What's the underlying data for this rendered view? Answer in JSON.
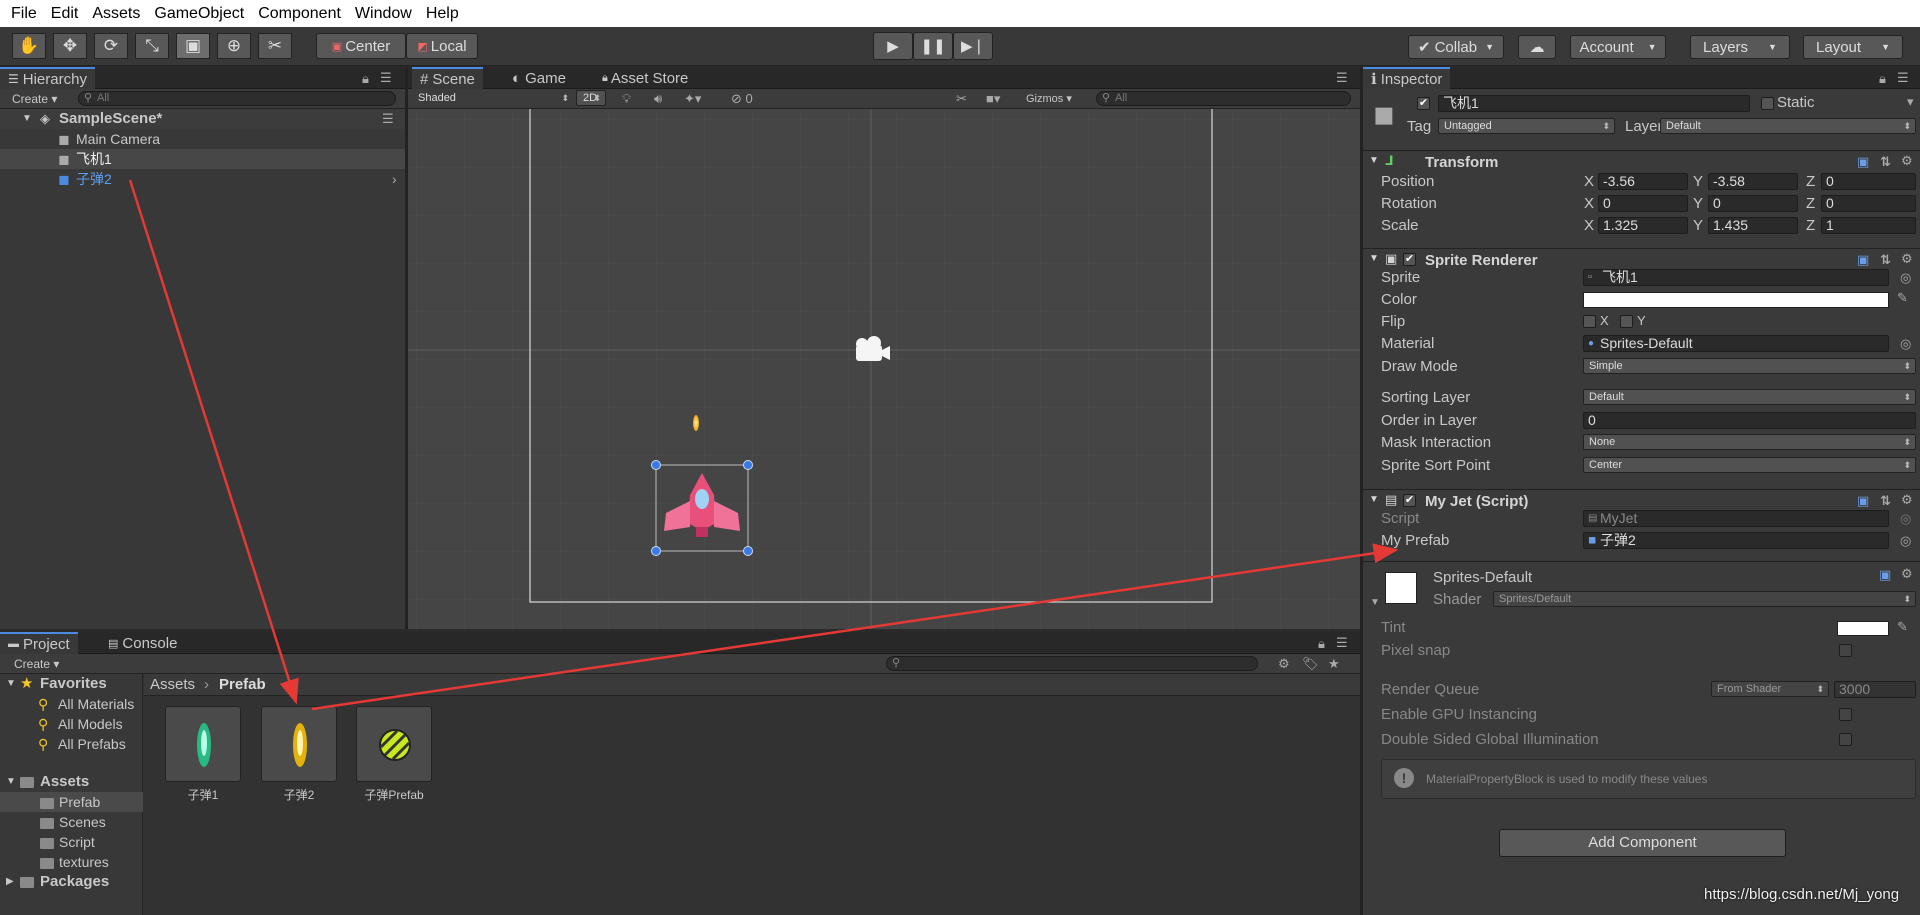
{
  "menu": [
    "File",
    "Edit",
    "Assets",
    "GameObject",
    "Component",
    "Window",
    "Help"
  ],
  "toolbar": {
    "center_label": "Center",
    "local_label": "Local",
    "collab_label": "Collab",
    "account_label": "Account",
    "layers_label": "Layers",
    "layout_label": "Layout"
  },
  "hierarchy": {
    "tab": "Hierarchy",
    "create": "Create",
    "search_placeholder": "All",
    "scene": "SampleScene*",
    "items": [
      "Main Camera",
      "飞机1",
      "子弹2"
    ]
  },
  "scene_view": {
    "tabs": [
      "Scene",
      "Game",
      "Asset Store"
    ],
    "shading": "Shaded",
    "mode_2d": "2D",
    "hidden_count": "0",
    "gizmos": "Gizmos",
    "search_placeholder": "All"
  },
  "project": {
    "tabs": [
      "Project",
      "Console"
    ],
    "create": "Create",
    "favorites_label": "Favorites",
    "favorites": [
      "All Materials",
      "All Models",
      "All Prefabs"
    ],
    "assets_label": "Assets",
    "folders": [
      "Prefab",
      "Scenes",
      "Script",
      "textures"
    ],
    "packages_label": "Packages",
    "breadcrumb": [
      "Assets",
      "Prefab"
    ],
    "assets": [
      {
        "name": "子弹1",
        "color": "#2fe8a0"
      },
      {
        "name": "子弹2",
        "color": "#ffd21a"
      },
      {
        "name": "子弹Prefab",
        "color": "#c8e820"
      }
    ]
  },
  "inspector": {
    "tab": "Inspector",
    "object_name": "飞机1",
    "static_label": "Static",
    "tag_label": "Tag",
    "tag_value": "Untagged",
    "layer_label": "Layer",
    "layer_value": "Default",
    "transform": {
      "title": "Transform",
      "position_label": "Position",
      "rotation_label": "Rotation",
      "scale_label": "Scale",
      "position": [
        "-3.56",
        "-3.58",
        "0"
      ],
      "rotation": [
        "0",
        "0",
        "0"
      ],
      "scale": [
        "1.325",
        "1.435",
        "1"
      ],
      "axes": [
        "X",
        "Y",
        "Z"
      ]
    },
    "sprite_renderer": {
      "title": "Sprite Renderer",
      "sprite_label": "Sprite",
      "sprite_value": "飞机1",
      "color_label": "Color",
      "flip_label": "Flip",
      "flip_x": "X",
      "flip_y": "Y",
      "material_label": "Material",
      "material_value": "Sprites-Default",
      "draw_mode_label": "Draw Mode",
      "draw_mode_value": "Simple",
      "sorting_layer_label": "Sorting Layer",
      "sorting_layer_value": "Default",
      "order_label": "Order in Layer",
      "order_value": "0",
      "mask_label": "Mask Interaction",
      "mask_value": "None",
      "sort_point_label": "Sprite Sort Point",
      "sort_point_value": "Center"
    },
    "my_jet": {
      "title": "My Jet (Script)",
      "script_label": "Script",
      "script_value": "MyJet",
      "prefab_label": "My Prefab",
      "prefab_value": "子弹2"
    },
    "material": {
      "name": "Sprites-Default",
      "shader_label": "Shader",
      "shader_value": "Sprites/Default",
      "tint_label": "Tint",
      "pixel_snap_label": "Pixel snap",
      "render_queue_label": "Render Queue",
      "render_queue_mode": "From Shader",
      "render_queue_value": "3000",
      "gpu_label": "Enable GPU Instancing",
      "dsgi_label": "Double Sided Global Illumination",
      "info": "MaterialPropertyBlock is used to modify these values"
    },
    "add_component": "Add Component"
  },
  "watermark": "https://blog.csdn.net/Mj_yong",
  "colors": {
    "accent": "#4a8ae0",
    "arrow": "#e53935"
  }
}
